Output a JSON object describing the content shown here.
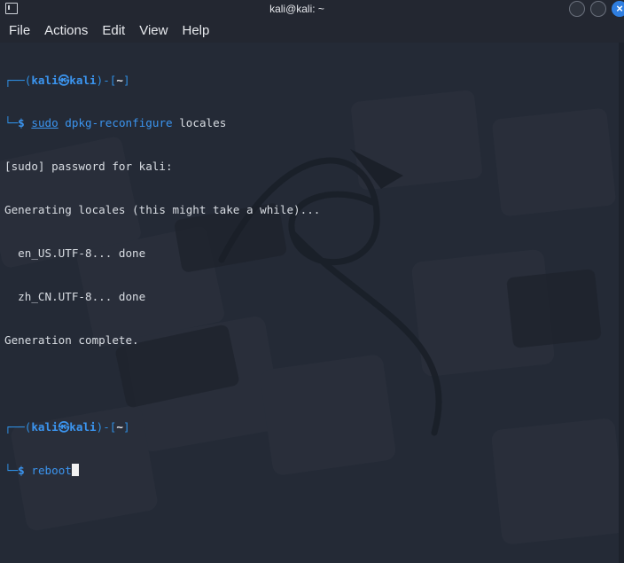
{
  "window": {
    "title": "kali@kali: ~"
  },
  "menu": {
    "items": [
      "File",
      "Actions",
      "Edit",
      "View",
      "Help"
    ]
  },
  "terminal": {
    "prompt1": {
      "open": "┌──(",
      "user": "kali",
      "at": "㉿",
      "host": "kali",
      "mid": ")-[",
      "dir": "~",
      "close": "]"
    },
    "cmd1": {
      "corner": "└─",
      "dollar": "$",
      "sudo": "sudo",
      "bin": "dpkg-reconfigure",
      "arg": "locales"
    },
    "output": [
      "[sudo] password for kali:",
      "Generating locales (this might take a while)...",
      "  en_US.UTF-8... done",
      "  zh_CN.UTF-8... done",
      "Generation complete."
    ],
    "prompt2": {
      "open": "┌──(",
      "user": "kali",
      "at": "㉿",
      "host": "kali",
      "mid": ")-[",
      "dir": "~",
      "close": "]"
    },
    "cmd2": {
      "corner": "└─",
      "dollar": "$",
      "text": "reboot"
    }
  },
  "colors": {
    "accent": "#3b95f0",
    "background": "#242a36",
    "close_button": "#2f7ee0"
  }
}
